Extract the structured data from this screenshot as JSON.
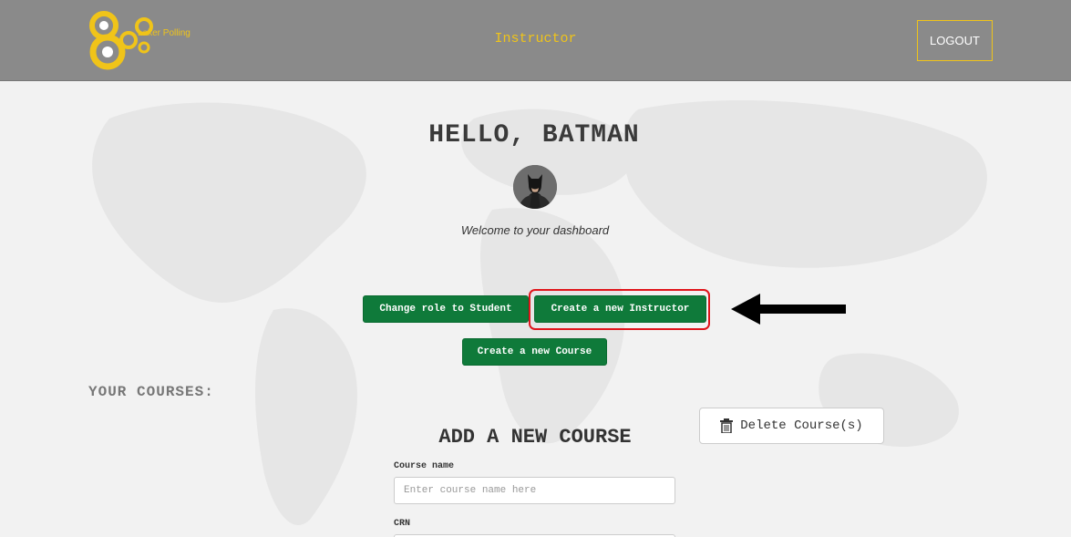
{
  "header": {
    "logo_text": "Laker Polling",
    "role_title": "Instructor",
    "logout_label": "LOGOUT"
  },
  "greeting": {
    "hello": "HELLO, BATMAN",
    "welcome": "Welcome to your dashboard"
  },
  "actions": {
    "change_role_label": "Change role to Student",
    "create_instructor_label": "Create a new Instructor",
    "create_course_label": "Create a new Course"
  },
  "courses": {
    "heading": "YOUR COURSES:",
    "delete_label": "Delete Course(s)"
  },
  "add_course": {
    "title": "ADD A NEW COURSE",
    "name_label": "Course name",
    "name_placeholder": "Enter course name here",
    "crn_label": "CRN"
  },
  "colors": {
    "header_bg": "#8a8a8a",
    "accent_yellow": "#f0c419",
    "button_green": "#0f7a3a",
    "highlight_red": "#e0151b"
  },
  "icons": [
    "logo-icon",
    "avatar-image",
    "arrow-icon",
    "trash-icon"
  ]
}
